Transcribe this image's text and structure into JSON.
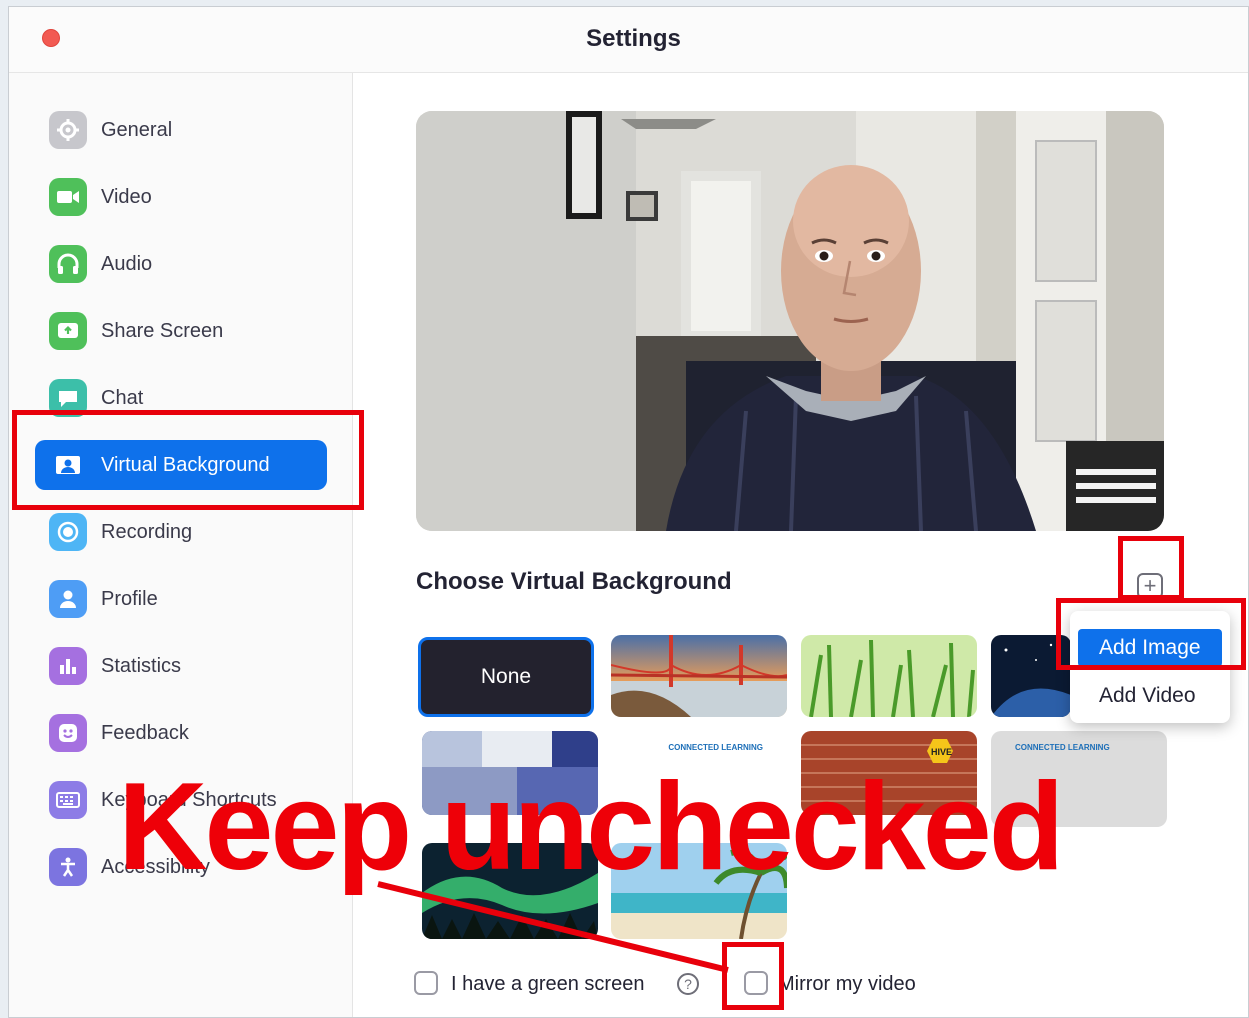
{
  "window": {
    "title": "Settings"
  },
  "sidebar": {
    "items": [
      {
        "label": "General",
        "icon": "gear-icon",
        "color": "#b9b9c0"
      },
      {
        "label": "Video",
        "icon": "video-camera-icon",
        "color": "#4fc05a"
      },
      {
        "label": "Audio",
        "icon": "headphones-icon",
        "color": "#4fc05a"
      },
      {
        "label": "Share Screen",
        "icon": "share-screen-icon",
        "color": "#4fc05a"
      },
      {
        "label": "Chat",
        "icon": "chat-bubble-icon",
        "color": "#3cbfa9"
      },
      {
        "label": "Virtual Background",
        "icon": "portrait-icon",
        "color": "#ffffff",
        "active": true
      },
      {
        "label": "Recording",
        "icon": "record-icon",
        "color": "#4eb5f5"
      },
      {
        "label": "Profile",
        "icon": "person-icon",
        "color": "#4e9df5"
      },
      {
        "label": "Statistics",
        "icon": "bar-chart-icon",
        "color": "#a570e0"
      },
      {
        "label": "Feedback",
        "icon": "smiley-icon",
        "color": "#a570e0"
      },
      {
        "label": "Keyboard Shortcuts",
        "icon": "keyboard-icon",
        "color": "#8d7ce6"
      },
      {
        "label": "Accessibility",
        "icon": "accessibility-icon",
        "color": "#7c74e0"
      }
    ]
  },
  "main": {
    "section_title": "Choose Virtual Background",
    "add_button_icon": "plus-icon",
    "thumbnails": {
      "none_label": "None",
      "logo_text": "CONNECTED LEARNING",
      "hive_text": "HIVE"
    },
    "dropdown": {
      "add_image": "Add Image",
      "add_video": "Add Video"
    },
    "green_screen_label": "I have a green screen",
    "help_symbol": "?",
    "mirror_label": "Mirror my video"
  },
  "annotation": {
    "text": "Keep unchecked",
    "color": "#e8000b"
  },
  "colors": {
    "accent": "#0e71eb",
    "annotation": "#e8000b"
  }
}
